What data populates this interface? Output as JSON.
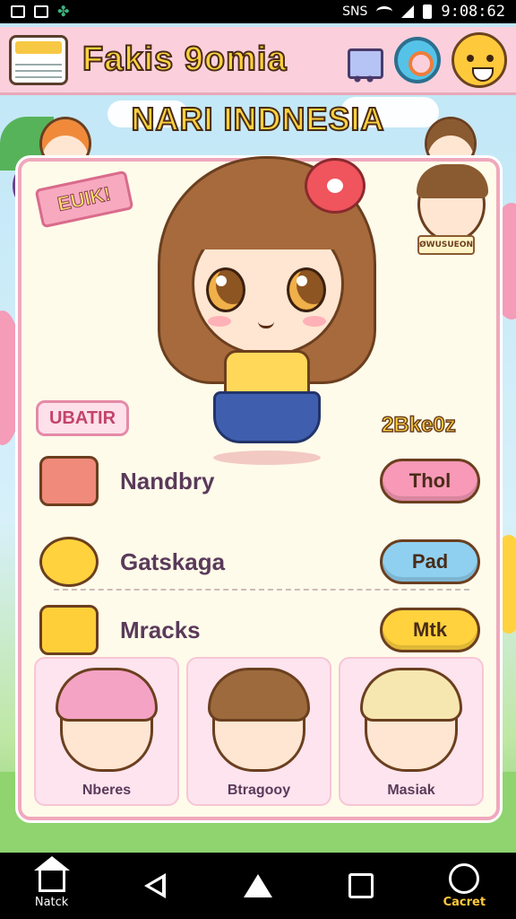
{
  "status_bar": {
    "time": "9:08:62",
    "carrier": "SNS"
  },
  "header": {
    "title": "Fakis 9omia"
  },
  "subtitle": "NARI INDNESIA",
  "ribbon": "EUIK!",
  "hero_sign": "ØWUSUEON",
  "tag": "UBATIR",
  "score": "2Bke0z",
  "rows": [
    {
      "label": "Nandbry",
      "button": "Thol",
      "btn_color": "#f799b7",
      "icon_color": "#f08a7a"
    },
    {
      "label": "Gatskaga",
      "button": "Pad",
      "btn_color": "#8fd0f0",
      "icon_color": "#ffd23e"
    },
    {
      "label": "Mracks",
      "button": "Mtk",
      "btn_color": "#ffd23e",
      "icon_color": "#ffcf3a"
    }
  ],
  "characters": [
    {
      "name": "Nberes",
      "hair_color": "#f4a3c4"
    },
    {
      "name": "Btragooy",
      "hair_color": "#9c6a3c"
    },
    {
      "name": "Masiak",
      "hair_color": "#f6e7b0"
    }
  ],
  "nav": {
    "home_label": "Natck",
    "game_label": "Cacret"
  }
}
